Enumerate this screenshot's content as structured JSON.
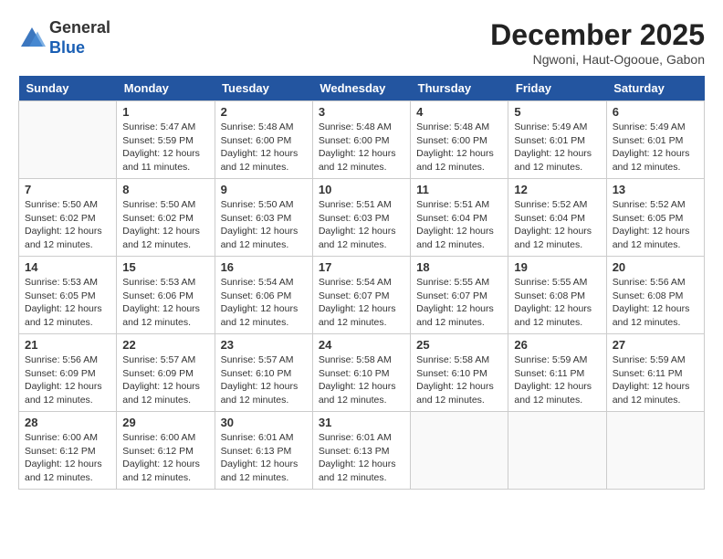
{
  "header": {
    "logo_line1": "General",
    "logo_line2": "Blue",
    "month": "December 2025",
    "location": "Ngwoni, Haut-Ogooue, Gabon"
  },
  "weekdays": [
    "Sunday",
    "Monday",
    "Tuesday",
    "Wednesday",
    "Thursday",
    "Friday",
    "Saturday"
  ],
  "weeks": [
    [
      {
        "day": "",
        "info": ""
      },
      {
        "day": "1",
        "info": "Sunrise: 5:47 AM\nSunset: 5:59 PM\nDaylight: 12 hours\nand 11 minutes."
      },
      {
        "day": "2",
        "info": "Sunrise: 5:48 AM\nSunset: 6:00 PM\nDaylight: 12 hours\nand 12 minutes."
      },
      {
        "day": "3",
        "info": "Sunrise: 5:48 AM\nSunset: 6:00 PM\nDaylight: 12 hours\nand 12 minutes."
      },
      {
        "day": "4",
        "info": "Sunrise: 5:48 AM\nSunset: 6:00 PM\nDaylight: 12 hours\nand 12 minutes."
      },
      {
        "day": "5",
        "info": "Sunrise: 5:49 AM\nSunset: 6:01 PM\nDaylight: 12 hours\nand 12 minutes."
      },
      {
        "day": "6",
        "info": "Sunrise: 5:49 AM\nSunset: 6:01 PM\nDaylight: 12 hours\nand 12 minutes."
      }
    ],
    [
      {
        "day": "7",
        "info": "Sunrise: 5:50 AM\nSunset: 6:02 PM\nDaylight: 12 hours\nand 12 minutes."
      },
      {
        "day": "8",
        "info": "Sunrise: 5:50 AM\nSunset: 6:02 PM\nDaylight: 12 hours\nand 12 minutes."
      },
      {
        "day": "9",
        "info": "Sunrise: 5:50 AM\nSunset: 6:03 PM\nDaylight: 12 hours\nand 12 minutes."
      },
      {
        "day": "10",
        "info": "Sunrise: 5:51 AM\nSunset: 6:03 PM\nDaylight: 12 hours\nand 12 minutes."
      },
      {
        "day": "11",
        "info": "Sunrise: 5:51 AM\nSunset: 6:04 PM\nDaylight: 12 hours\nand 12 minutes."
      },
      {
        "day": "12",
        "info": "Sunrise: 5:52 AM\nSunset: 6:04 PM\nDaylight: 12 hours\nand 12 minutes."
      },
      {
        "day": "13",
        "info": "Sunrise: 5:52 AM\nSunset: 6:05 PM\nDaylight: 12 hours\nand 12 minutes."
      }
    ],
    [
      {
        "day": "14",
        "info": "Sunrise: 5:53 AM\nSunset: 6:05 PM\nDaylight: 12 hours\nand 12 minutes."
      },
      {
        "day": "15",
        "info": "Sunrise: 5:53 AM\nSunset: 6:06 PM\nDaylight: 12 hours\nand 12 minutes."
      },
      {
        "day": "16",
        "info": "Sunrise: 5:54 AM\nSunset: 6:06 PM\nDaylight: 12 hours\nand 12 minutes."
      },
      {
        "day": "17",
        "info": "Sunrise: 5:54 AM\nSunset: 6:07 PM\nDaylight: 12 hours\nand 12 minutes."
      },
      {
        "day": "18",
        "info": "Sunrise: 5:55 AM\nSunset: 6:07 PM\nDaylight: 12 hours\nand 12 minutes."
      },
      {
        "day": "19",
        "info": "Sunrise: 5:55 AM\nSunset: 6:08 PM\nDaylight: 12 hours\nand 12 minutes."
      },
      {
        "day": "20",
        "info": "Sunrise: 5:56 AM\nSunset: 6:08 PM\nDaylight: 12 hours\nand 12 minutes."
      }
    ],
    [
      {
        "day": "21",
        "info": "Sunrise: 5:56 AM\nSunset: 6:09 PM\nDaylight: 12 hours\nand 12 minutes."
      },
      {
        "day": "22",
        "info": "Sunrise: 5:57 AM\nSunset: 6:09 PM\nDaylight: 12 hours\nand 12 minutes."
      },
      {
        "day": "23",
        "info": "Sunrise: 5:57 AM\nSunset: 6:10 PM\nDaylight: 12 hours\nand 12 minutes."
      },
      {
        "day": "24",
        "info": "Sunrise: 5:58 AM\nSunset: 6:10 PM\nDaylight: 12 hours\nand 12 minutes."
      },
      {
        "day": "25",
        "info": "Sunrise: 5:58 AM\nSunset: 6:10 PM\nDaylight: 12 hours\nand 12 minutes."
      },
      {
        "day": "26",
        "info": "Sunrise: 5:59 AM\nSunset: 6:11 PM\nDaylight: 12 hours\nand 12 minutes."
      },
      {
        "day": "27",
        "info": "Sunrise: 5:59 AM\nSunset: 6:11 PM\nDaylight: 12 hours\nand 12 minutes."
      }
    ],
    [
      {
        "day": "28",
        "info": "Sunrise: 6:00 AM\nSunset: 6:12 PM\nDaylight: 12 hours\nand 12 minutes."
      },
      {
        "day": "29",
        "info": "Sunrise: 6:00 AM\nSunset: 6:12 PM\nDaylight: 12 hours\nand 12 minutes."
      },
      {
        "day": "30",
        "info": "Sunrise: 6:01 AM\nSunset: 6:13 PM\nDaylight: 12 hours\nand 12 minutes."
      },
      {
        "day": "31",
        "info": "Sunrise: 6:01 AM\nSunset: 6:13 PM\nDaylight: 12 hours\nand 12 minutes."
      },
      {
        "day": "",
        "info": ""
      },
      {
        "day": "",
        "info": ""
      },
      {
        "day": "",
        "info": ""
      }
    ]
  ]
}
